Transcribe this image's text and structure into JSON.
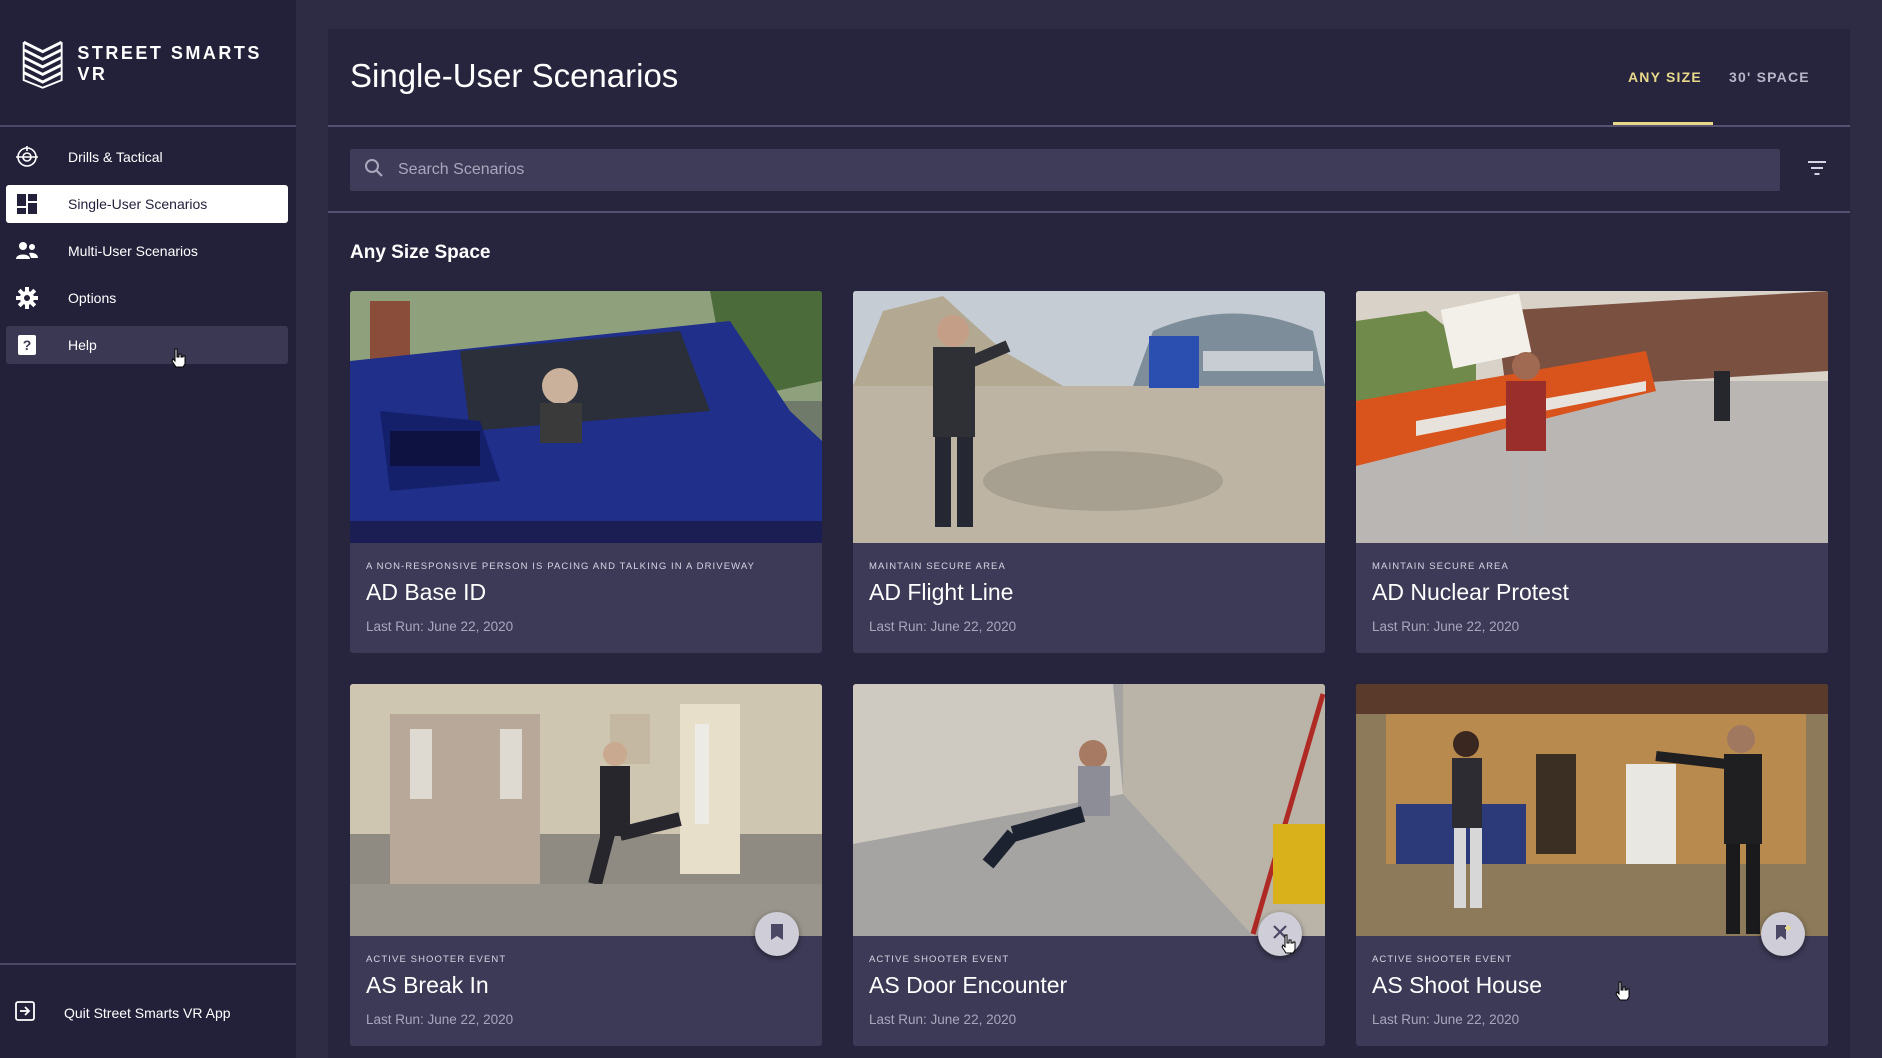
{
  "app": {
    "name": "STREET SMARTS VR"
  },
  "sidebar": {
    "items": [
      {
        "label": "Drills & Tactical",
        "icon": "crosshair-icon"
      },
      {
        "label": "Single-User Scenarios",
        "icon": "dashboard-icon",
        "active": true
      },
      {
        "label": "Multi-User Scenarios",
        "icon": "people-icon"
      },
      {
        "label": "Options",
        "icon": "gear-icon"
      },
      {
        "label": "Help",
        "icon": "help-icon",
        "hovered": true
      }
    ],
    "quit_label": "Quit Street Smarts VR App"
  },
  "header": {
    "title": "Single-User Scenarios",
    "tabs": [
      {
        "label": "ANY SIZE",
        "active": true
      },
      {
        "label": "30' SPACE",
        "active": false
      }
    ]
  },
  "search": {
    "placeholder": "Search Scenarios",
    "value": ""
  },
  "section": {
    "title": "Any Size Space"
  },
  "cards": [
    {
      "category": "A NON-RESPONSIVE PERSON IS PACING AND TALKING IN A DRIVEWAY",
      "title": "AD Base ID",
      "last_run": "Last Run: June 22, 2020"
    },
    {
      "category": "MAINTAIN SECURE AREA",
      "title": "AD Flight Line",
      "last_run": "Last Run: June 22, 2020"
    },
    {
      "category": "MAINTAIN SECURE AREA",
      "title": "AD Nuclear Protest",
      "last_run": "Last Run: June 22, 2020"
    },
    {
      "category": "ACTIVE SHOOTER EVENT",
      "title": "AS Break In",
      "last_run": "Last Run: June 22, 2020",
      "action_icon": "bookmark-icon"
    },
    {
      "category": "ACTIVE SHOOTER EVENT",
      "title": "AS Door Encounter",
      "last_run": "Last Run: June 22, 2020",
      "action_icon": "close-icon"
    },
    {
      "category": "ACTIVE SHOOTER EVENT",
      "title": "AS Shoot House",
      "last_run": "Last Run: June 22, 2020",
      "action_icon": "bookmark-add-icon"
    }
  ],
  "colors": {
    "background": "#2e2c44",
    "sidebar": "#23213a",
    "panel": "#27253d",
    "card": "#3c3a56",
    "accent": "#e8d98a"
  }
}
